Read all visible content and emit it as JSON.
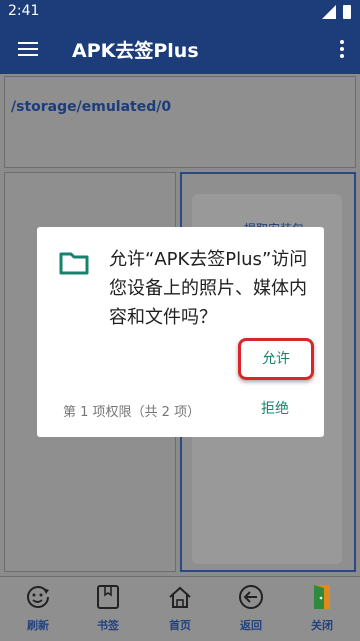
{
  "status_bar": {
    "time": "2:41"
  },
  "app_bar": {
    "title": "APK去签Plus"
  },
  "path_panel": {
    "path": "/storage/emulated/0"
  },
  "right_panel": {
    "extract_label": "提取安装包"
  },
  "bottom_nav": [
    {
      "label": "刷新",
      "icon": "refresh-smile-icon"
    },
    {
      "label": "书签",
      "icon": "bookmark-icon"
    },
    {
      "label": "首页",
      "icon": "home-icon"
    },
    {
      "label": "返回",
      "icon": "back-arrow-icon"
    },
    {
      "label": "关闭",
      "icon": "exit-door-icon"
    }
  ],
  "dialog": {
    "message": "允许“APK去签Plus”访问您设备上的照片、媒体内容和文件吗？",
    "allow_label": "允许",
    "permission_count": "第 1 项权限（共 2 项）",
    "deny_label": "拒绝"
  },
  "colors": {
    "app_bar": "#1c3d7a",
    "accent": "#17836b",
    "highlight": "#d9262a"
  }
}
